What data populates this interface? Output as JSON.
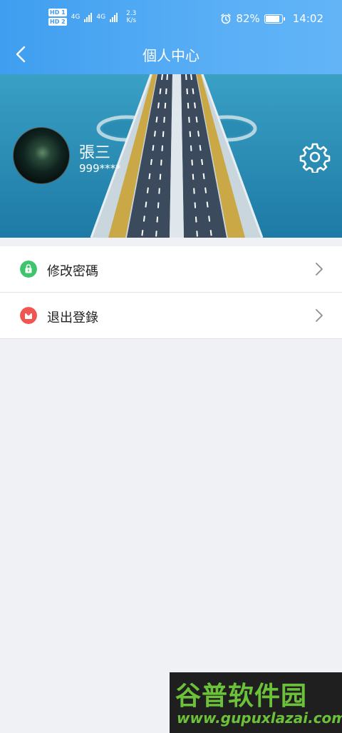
{
  "status_bar": {
    "hd1": "HD 1",
    "hd2": "HD 2",
    "net1": "4G",
    "net2": "4G",
    "speed_value": "2.3",
    "speed_unit": "K/s",
    "battery": "82%",
    "time": "14:02"
  },
  "header": {
    "title": "個人中心",
    "gradient_from": "#3f9ef0",
    "gradient_to": "#62b4f7"
  },
  "profile": {
    "name": "張三",
    "id": "999****"
  },
  "menu": [
    {
      "label": "修改密碼",
      "icon": "lock-icon",
      "color": "#3ec46d"
    },
    {
      "label": "退出登錄",
      "icon": "logout-icon",
      "color": "#f0564f"
    }
  ],
  "watermark": {
    "title": "谷普软件园",
    "url": "www.gupuxlazai.com"
  }
}
